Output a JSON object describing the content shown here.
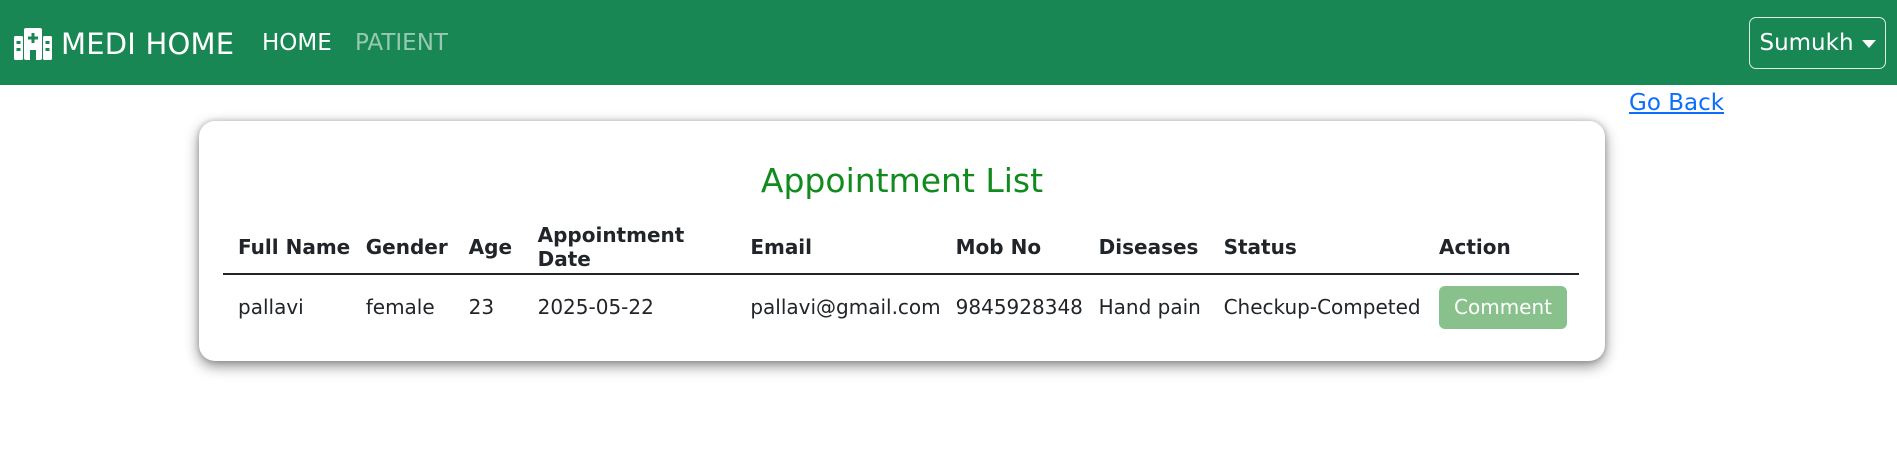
{
  "navbar": {
    "brand": "MEDI HOME",
    "brand_icon": "hospital-icon",
    "links": {
      "home": "HOME",
      "patient": "PATIENT"
    },
    "user": "Sumukh",
    "colors": {
      "background": "#198754"
    }
  },
  "go_back": "Go Back",
  "card": {
    "title": "Appointment List",
    "table": {
      "headers": [
        "Full Name",
        "Gender",
        "Age",
        "Appointment Date",
        "Email",
        "Mob No",
        "Diseases",
        "Status",
        "Action"
      ],
      "rows": [
        {
          "full_name": "pallavi",
          "gender": "female",
          "age": "23",
          "appointment_date": "2025-05-22",
          "email": "pallavi@gmail.com",
          "mob_no": "9845928348",
          "diseases": "Hand pain",
          "status": "Checkup-Competed",
          "action": "Comment"
        }
      ]
    }
  }
}
